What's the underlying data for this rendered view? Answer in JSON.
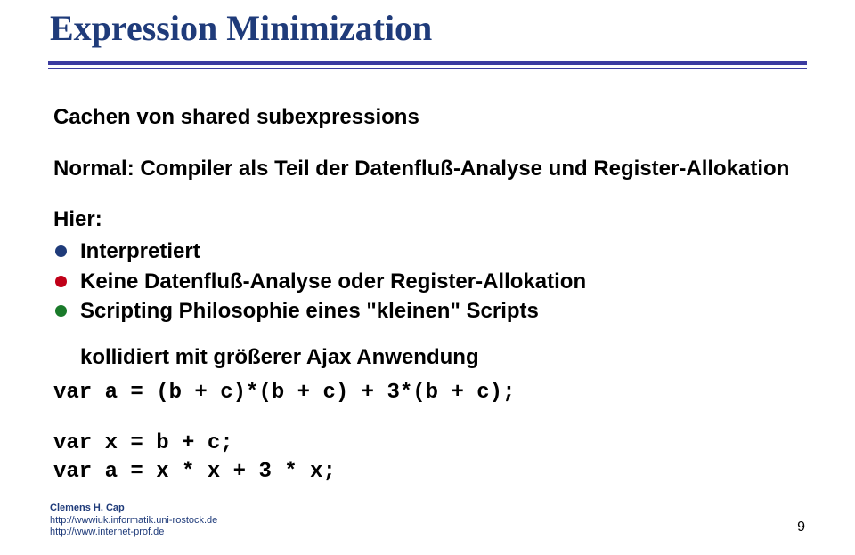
{
  "title": "Expression Minimization",
  "intro": "Cachen von shared subexpressions",
  "normal_line": "Normal: Compiler als Teil der Datenfluß-Analyse und Register-Allokation",
  "hier_label": "Hier:",
  "bullets": [
    "Interpretiert",
    "Keine Datenfluß-Analyse oder Register-Allokation",
    "Scripting Philosophie eines \"kleinen\" Scripts"
  ],
  "subline": "kollidiert mit größerer Ajax Anwendung",
  "code": {
    "line1": "var a = (b + c)*(b + c) + 3*(b + c);",
    "line2": "var x = b + c;",
    "line3": "var a = x * x + 3 * x;"
  },
  "footer": {
    "name": "Clemens H. Cap",
    "url1": "http://wwwiuk.informatik.uni-rostock.de",
    "url2": "http://www.internet-prof.de"
  },
  "page_number": "9"
}
